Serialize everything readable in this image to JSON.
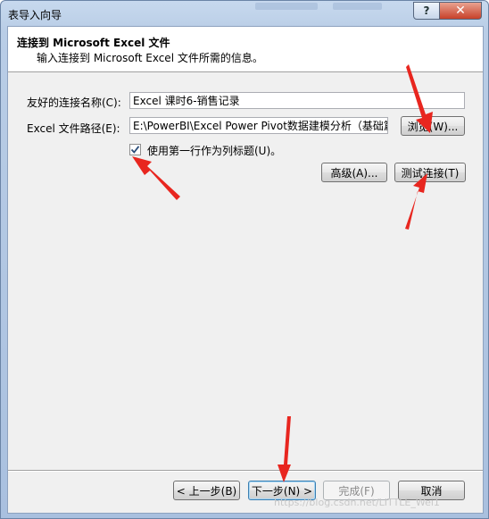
{
  "window": {
    "title": "表导入向导",
    "help_label": "?",
    "close_label": "✕"
  },
  "header": {
    "title": "连接到 Microsoft Excel 文件",
    "subtitle": "输入连接到 Microsoft Excel 文件所需的信息。"
  },
  "form": {
    "name_label": "友好的连接名称(C):",
    "name_value": "Excel 课时6-销售记录",
    "path_label": "Excel 文件路径(E):",
    "path_value": "E:\\PowerBI\\Excel Power Pivot数据建模分析（基础篇）\\i",
    "browse_label": "浏览(W)...",
    "checkbox_label": "使用第一行作为列标题(U)。",
    "checkbox_checked": true,
    "advanced_label": "高级(A)...",
    "test_label": "测试连接(T)"
  },
  "footer": {
    "back_label": "< 上一步(B)",
    "next_label": "下一步(N) >",
    "finish_label": "完成(F)",
    "cancel_label": "取消"
  },
  "watermark": "https://blog.csdn.net/LITTLE_Wei1"
}
